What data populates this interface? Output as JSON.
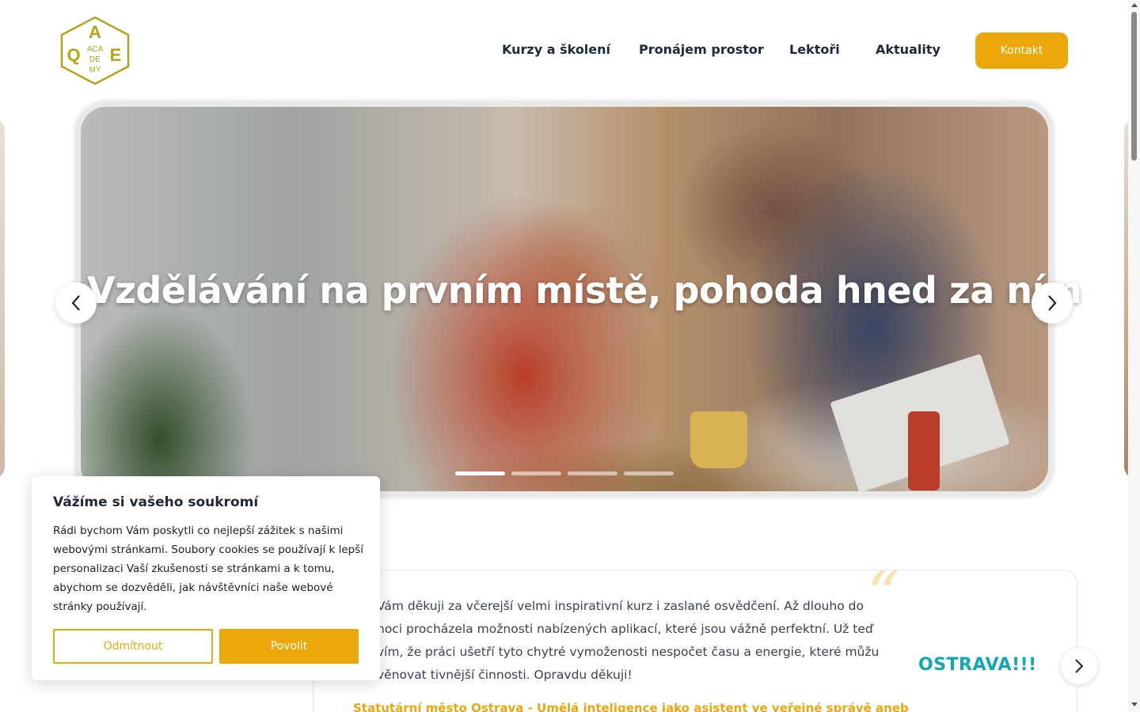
{
  "brand": {
    "logo_letters": {
      "top": "A",
      "left": "Q",
      "right": "E"
    },
    "logo_lines": [
      "ACA",
      "DE",
      "MY"
    ],
    "accent_color": "#eca80a"
  },
  "nav": {
    "items": [
      {
        "label": "Kurzy a školení"
      },
      {
        "label": "Pronájem prostor"
      },
      {
        "label": "Lektoři"
      },
      {
        "label": "Aktuality"
      }
    ],
    "contact_label": "Kontakt"
  },
  "hero": {
    "title": "Vzdělávání na prvním místě, pohoda hned za ním",
    "active_slide": 1,
    "slide_count": 4,
    "prev_icon": "chevron-left-icon",
    "next_icon": "chevron-right-icon"
  },
  "testimonial": {
    "text": "Vám děkuji za včerejší velmi inspirativní kurz i zaslané osvědčení. Až dlouho do noci procházela možnosti nabízených aplikací, které jsou vážně perfektní. Už teď vím, že práci ušetří tyto chytré vymoženosti nespočet času a energie, které můžu věnovat tivnější činnosti. Opravdu děkuji!",
    "author": "Statutární město Ostrava - Umělá inteligence jako asistent ve veřejné správě aneb",
    "client_logo": "OSTRAVA!!!",
    "quote_open": "“",
    "quote_close": "„"
  },
  "cookie": {
    "title": "Vážíme si vašeho soukromí",
    "text": "Rádi bychom Vám poskytli co nejlepší zážitek s našimi webovými stránkami. Soubory cookies se používají k lepší personalizaci Vaší zkušenosti se stránkami a k tomu, abychom se dozvěděli, jak návštěvníci naše webové stránky používají.",
    "reject_label": "Odmítnout",
    "accept_label": "Povolit"
  }
}
